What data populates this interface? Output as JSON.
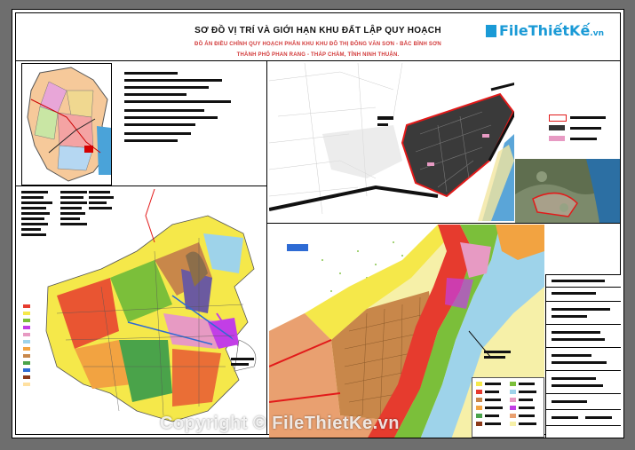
{
  "title": "SƠ ĐỒ VỊ TRÍ VÀ GIỚI HẠN KHU ĐẤT LẬP QUY HOẠCH",
  "subtitle_line1": "ĐỒ ÁN ĐIỀU CHỈNH QUY HOẠCH PHÂN KHU KHU ĐÔ THỊ ĐÔNG VĂN SƠN - BẮC BÌNH SƠN",
  "subtitle_line2": "THÀNH PHỐ PHAN RANG - THÁP CHÀM, TỈNH NINH THUẬN.",
  "logo": {
    "brand": "FileThiếtKế",
    "suffix": ".vn"
  },
  "watermark": "Copyright © FileThietKe.vn",
  "colors": {
    "residential": "#c8874a",
    "green": "#7bbf3a",
    "yellow": "#f5e84a",
    "water": "#9ed3ea",
    "red": "#e63b2e",
    "pink": "#e79ac3",
    "purple": "#c23ee6",
    "dark": "#333333",
    "orange": "#f2a341"
  },
  "panels": {
    "province_map": "province-location-map",
    "city_map": "city-overview-map",
    "site_map": "planning-boundary-map",
    "satellite": "satellite-inset",
    "detail_map": "detail-zoning-map",
    "title_block": "drawing-title-block"
  }
}
